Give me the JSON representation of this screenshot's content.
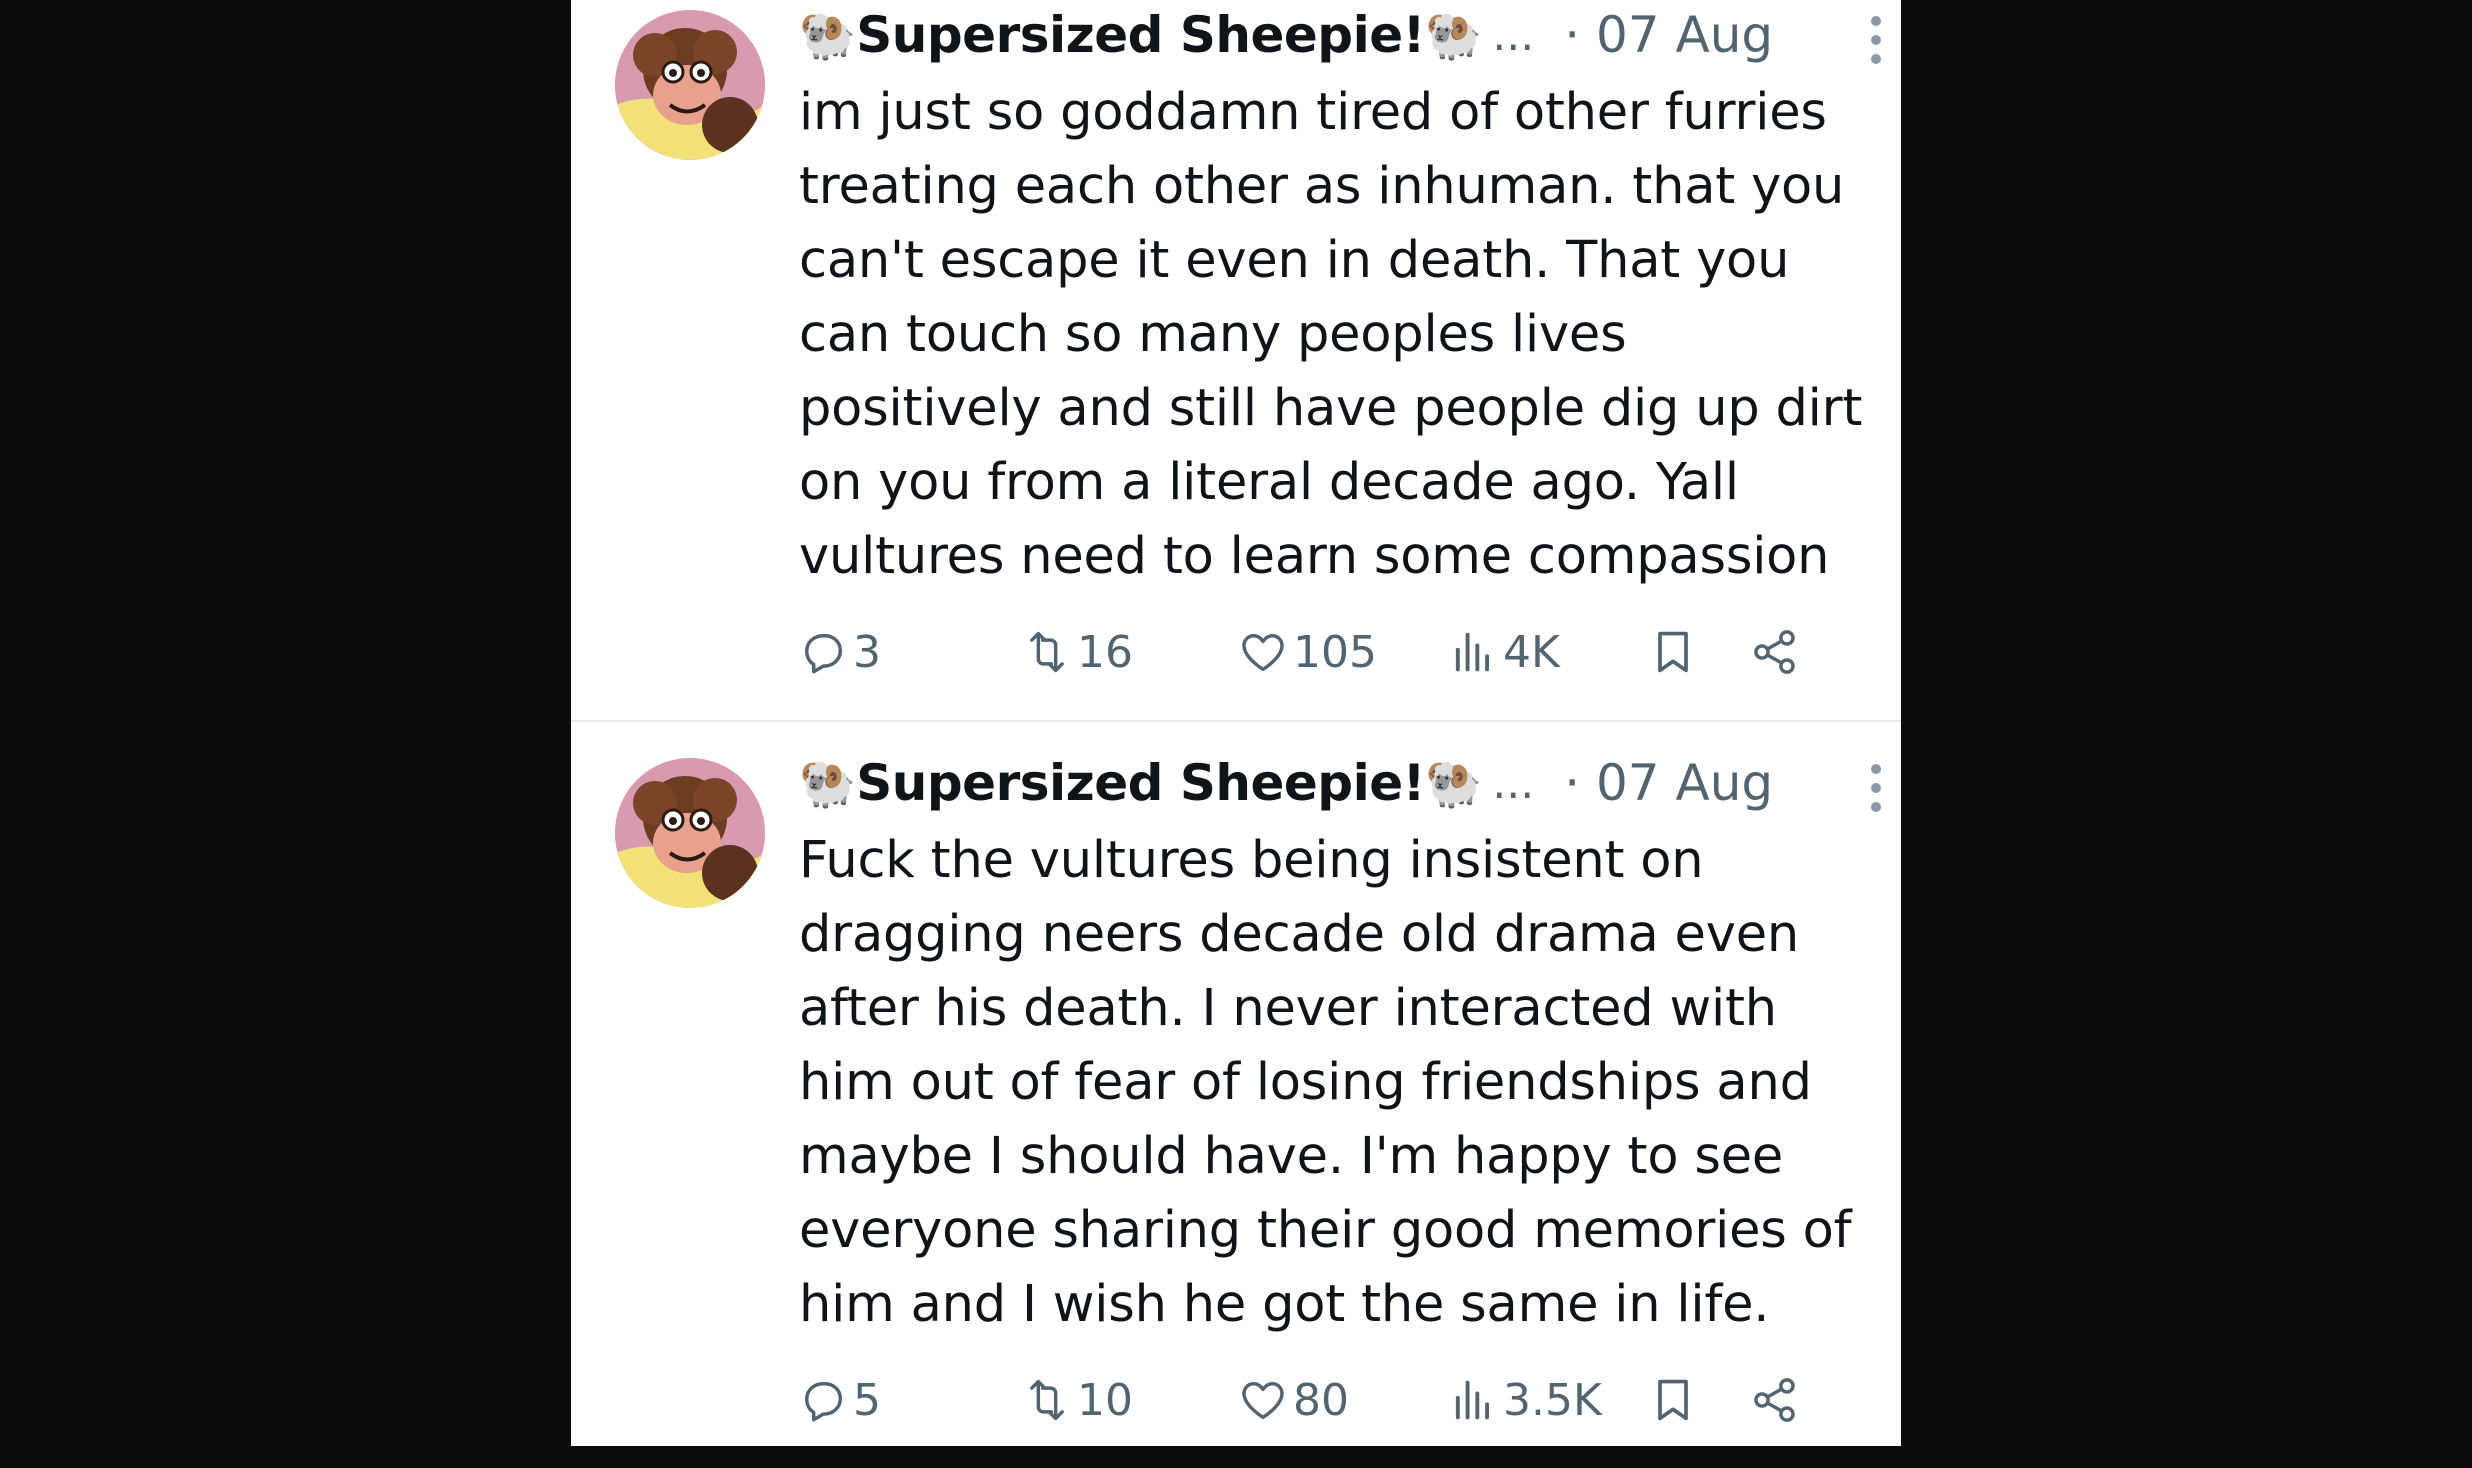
{
  "tweets": [
    {
      "author_prefix_emoji": "🐏",
      "author_name": "Supersized Sheepie!",
      "author_suffix_emoji": "🐏",
      "truncation": "...",
      "date": "· 07 Aug",
      "text": "im just so goddamn tired of other furries\ntreating each other as inhuman. that you\ncan't escape it even in death. That you\ncan touch so many peoples lives\npositively and still have people dig up dirt\non you from a literal decade ago. Yall\nvultures need to learn some compassion",
      "replies": "3",
      "reposts": "16",
      "likes": "105",
      "views": "4K"
    },
    {
      "author_prefix_emoji": "🐏",
      "author_name": "Supersized Sheepie!",
      "author_suffix_emoji": "🐏",
      "truncation": "...",
      "date": "· 07 Aug",
      "text": "Fuck the vultures being insistent on\ndragging neers decade old drama even\nafter his death. I never interacted with\nhim out of fear of losing friendships and\nmaybe I should have. I'm happy to see\neveryone sharing their good memories of\nhim and I wish he got the same in life.",
      "replies": "5",
      "reposts": "10",
      "likes": "80",
      "views": "3.5K"
    }
  ],
  "icons": {
    "reply": "reply-icon",
    "repost": "repost-icon",
    "like": "heart-icon",
    "views": "views-icon",
    "bookmark": "bookmark-icon",
    "share": "share-icon",
    "more": "more-vertical-icon"
  },
  "colors": {
    "text": "#0f1419",
    "muted": "#536471",
    "background": "#ffffff",
    "outer": "#0b0b0b"
  }
}
